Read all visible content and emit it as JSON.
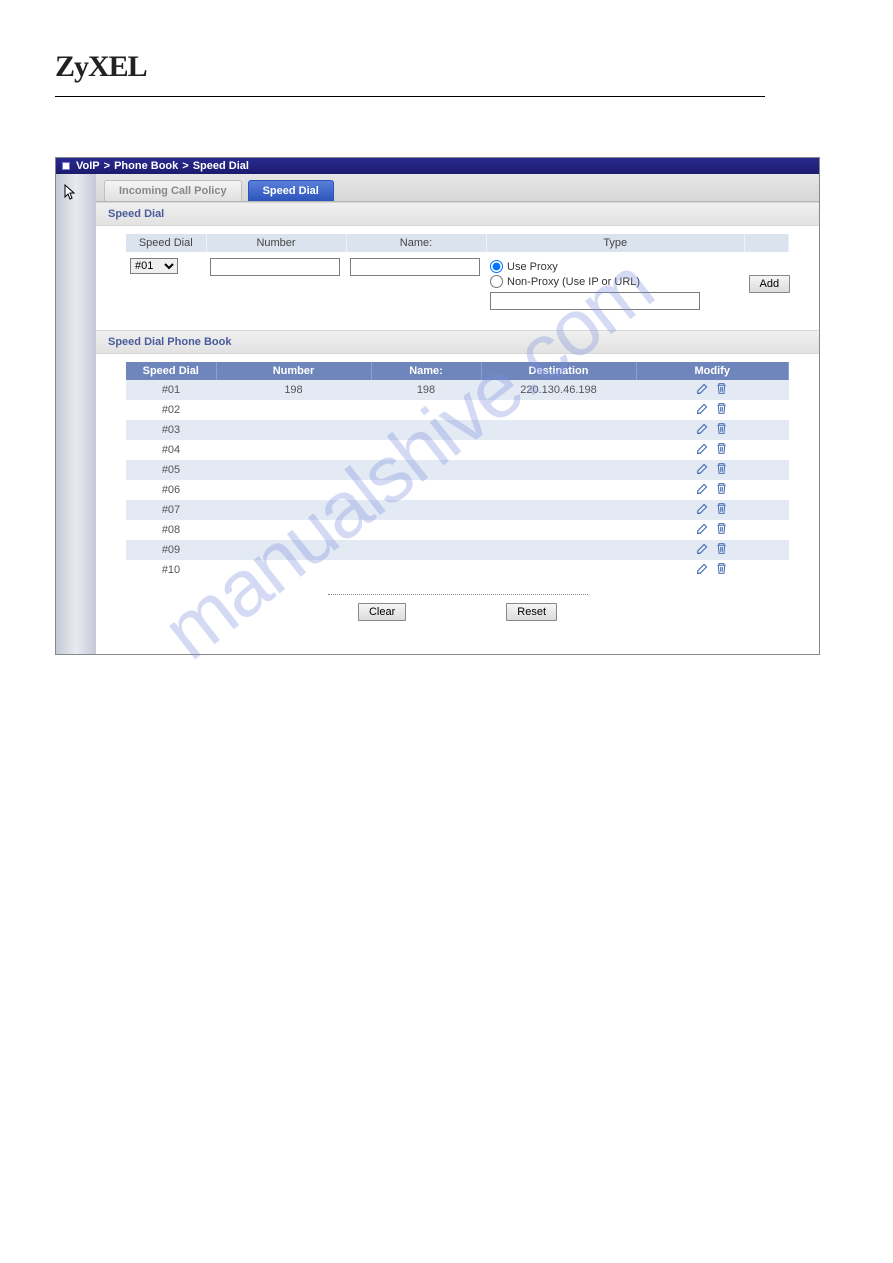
{
  "brand": "ZyXEL",
  "watermark_text": "manualshive.com",
  "breadcrumb": {
    "a": "VoIP",
    "b": "Phone Book",
    "c": "Speed Dial",
    "sep": ">"
  },
  "tabs": {
    "incoming": "Incoming Call Policy",
    "speeddial": "Speed Dial"
  },
  "section": {
    "speed_dial": "Speed Dial",
    "phonebook": "Speed Dial Phone Book"
  },
  "input_headers": {
    "speed_dial": "Speed Dial",
    "number": "Number",
    "name": "Name:",
    "type": "Type"
  },
  "dropdown_value": "#01",
  "radio": {
    "use_proxy": "Use Proxy",
    "non_proxy": "Non-Proxy (Use IP or URL)"
  },
  "buttons": {
    "add": "Add",
    "clear": "Clear",
    "reset": "Reset"
  },
  "table_headers": {
    "speed_dial": "Speed Dial",
    "number": "Number",
    "name": "Name:",
    "destination": "Destination",
    "modify": "Modify"
  },
  "rows": [
    {
      "sd": "#01",
      "number": "198",
      "name": "198",
      "dest": "220.130.46.198"
    },
    {
      "sd": "#02",
      "number": "",
      "name": "",
      "dest": ""
    },
    {
      "sd": "#03",
      "number": "",
      "name": "",
      "dest": ""
    },
    {
      "sd": "#04",
      "number": "",
      "name": "",
      "dest": ""
    },
    {
      "sd": "#05",
      "number": "",
      "name": "",
      "dest": ""
    },
    {
      "sd": "#06",
      "number": "",
      "name": "",
      "dest": ""
    },
    {
      "sd": "#07",
      "number": "",
      "name": "",
      "dest": ""
    },
    {
      "sd": "#08",
      "number": "",
      "name": "",
      "dest": ""
    },
    {
      "sd": "#09",
      "number": "",
      "name": "",
      "dest": ""
    },
    {
      "sd": "#10",
      "number": "",
      "name": "",
      "dest": ""
    }
  ]
}
